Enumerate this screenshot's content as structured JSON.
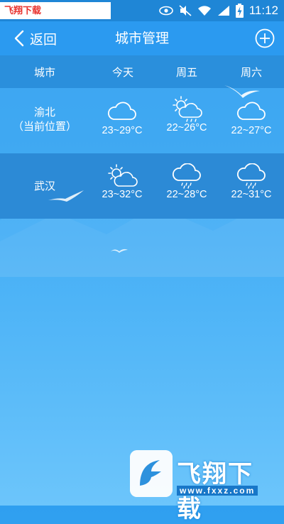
{
  "statusbar": {
    "watermark": "飞翔下载 www.FXXZ.com",
    "time": "11:12",
    "icons": [
      "eye-icon",
      "mute-icon",
      "wifi-icon",
      "signal-icon",
      "battery-charging-icon"
    ]
  },
  "header": {
    "back_label": "返回",
    "title": "城市管理",
    "add_icon": "plus-circle-icon"
  },
  "columns": [
    "城市",
    "今天",
    "周五",
    "周六"
  ],
  "cities": [
    {
      "name": "渝北",
      "subtitle": "（当前位置）",
      "forecast": [
        {
          "icon": "cloudy-icon",
          "temp": "23~29°C"
        },
        {
          "icon": "partly-cloudy-rain-icon",
          "temp": "22~26°C"
        },
        {
          "icon": "cloudy-icon",
          "temp": "22~27°C"
        }
      ]
    },
    {
      "name": "武汉",
      "subtitle": "",
      "forecast": [
        {
          "icon": "partly-cloudy-icon",
          "temp": "23~32°C"
        },
        {
          "icon": "rain-icon",
          "temp": "22~28°C"
        },
        {
          "icon": "rain-icon",
          "temp": "22~31°C"
        }
      ]
    }
  ],
  "logo": {
    "text": "飞翔下载",
    "url": "www.fxxz.com"
  },
  "colors": {
    "header": "#2b9af0",
    "statusbar": "#1f86d6",
    "watermark_red": "#e8322e"
  }
}
